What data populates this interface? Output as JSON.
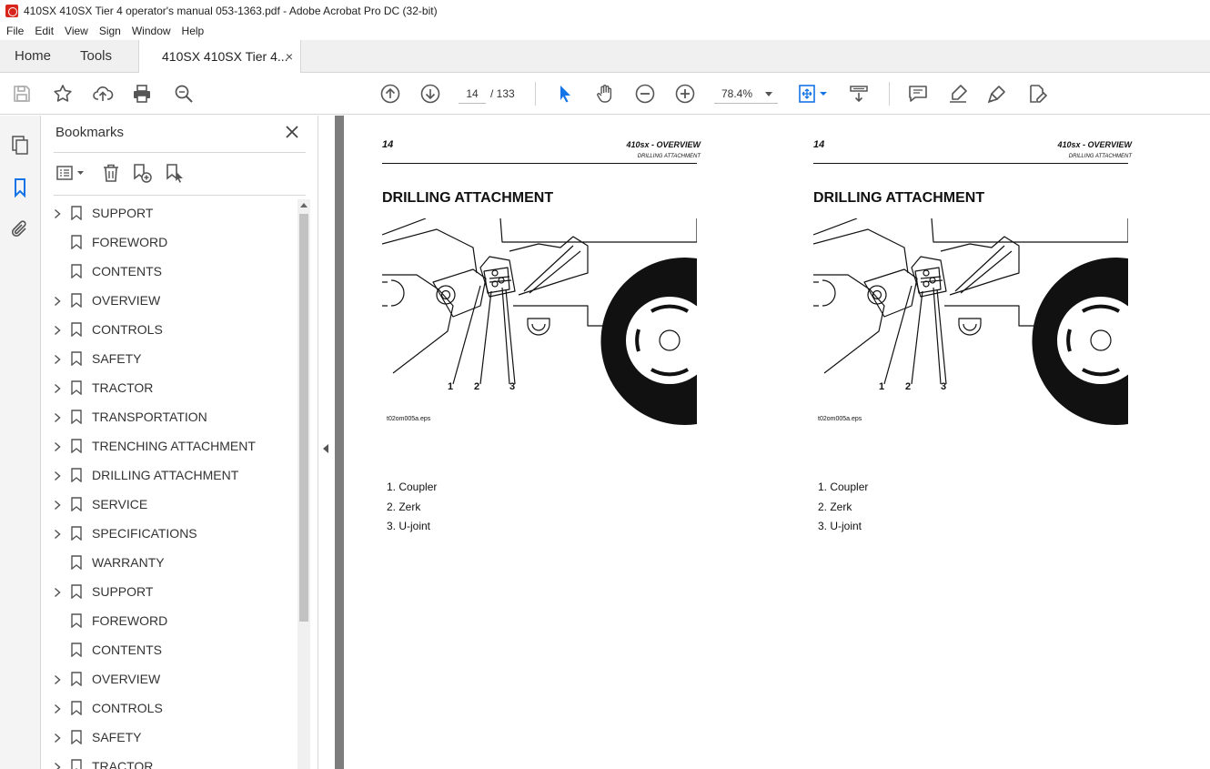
{
  "window": {
    "title": "410SX 410SX Tier 4 operator's manual 053-1363.pdf - Adobe Acrobat Pro DC (32-bit)"
  },
  "menu": [
    "File",
    "Edit",
    "View",
    "Sign",
    "Window",
    "Help"
  ],
  "tabs": {
    "home": "Home",
    "tools": "Tools",
    "doc": "410SX 410SX Tier 4...",
    "close": "×"
  },
  "toolbar": {
    "page_current": "14",
    "page_total": "/ 133",
    "zoom": "78.4%"
  },
  "bookmarks": {
    "header": "Bookmarks",
    "items": [
      {
        "label": "SUPPORT",
        "expandable": true
      },
      {
        "label": "FOREWORD",
        "expandable": false
      },
      {
        "label": "CONTENTS",
        "expandable": false
      },
      {
        "label": "OVERVIEW",
        "expandable": true
      },
      {
        "label": "CONTROLS",
        "expandable": true
      },
      {
        "label": "SAFETY",
        "expandable": true
      },
      {
        "label": "TRACTOR",
        "expandable": true
      },
      {
        "label": "TRANSPORTATION",
        "expandable": true
      },
      {
        "label": "TRENCHING ATTACHMENT",
        "expandable": true
      },
      {
        "label": "DRILLING ATTACHMENT",
        "expandable": true
      },
      {
        "label": "SERVICE",
        "expandable": true
      },
      {
        "label": "SPECIFICATIONS",
        "expandable": true
      },
      {
        "label": "WARRANTY",
        "expandable": false
      },
      {
        "label": "SUPPORT",
        "expandable": true
      },
      {
        "label": "FOREWORD",
        "expandable": false
      },
      {
        "label": "CONTENTS",
        "expandable": false
      },
      {
        "label": "OVERVIEW",
        "expandable": true
      },
      {
        "label": "CONTROLS",
        "expandable": true
      },
      {
        "label": "SAFETY",
        "expandable": true
      },
      {
        "label": "TRACTOR",
        "expandable": true
      }
    ]
  },
  "pages": [
    {
      "page_number": "14",
      "header_title": "410sx - OVERVIEW",
      "header_subtitle": "DRILLING ATTACHMENT",
      "title": "DRILLING ATTACHMENT",
      "callouts": [
        "1",
        "2",
        "3"
      ],
      "figure_name": "t02om005a.eps",
      "legend": [
        "1. Coupler",
        "2. Zerk",
        "3. U-joint"
      ]
    },
    {
      "page_number": "14",
      "header_title": "410sx - OVERVIEW",
      "header_subtitle": "DRILLING ATTACHMENT",
      "title": "DRILLING ATTACHMENT",
      "callouts": [
        "1",
        "2",
        "3"
      ],
      "figure_name": "t02om005a.eps",
      "legend": [
        "1. Coupler",
        "2. Zerk",
        "3. U-joint"
      ]
    }
  ],
  "colors": {
    "accent_blue": "#1473e6",
    "icon_gray": "#555555",
    "doc_background": "#7d7d7d"
  }
}
